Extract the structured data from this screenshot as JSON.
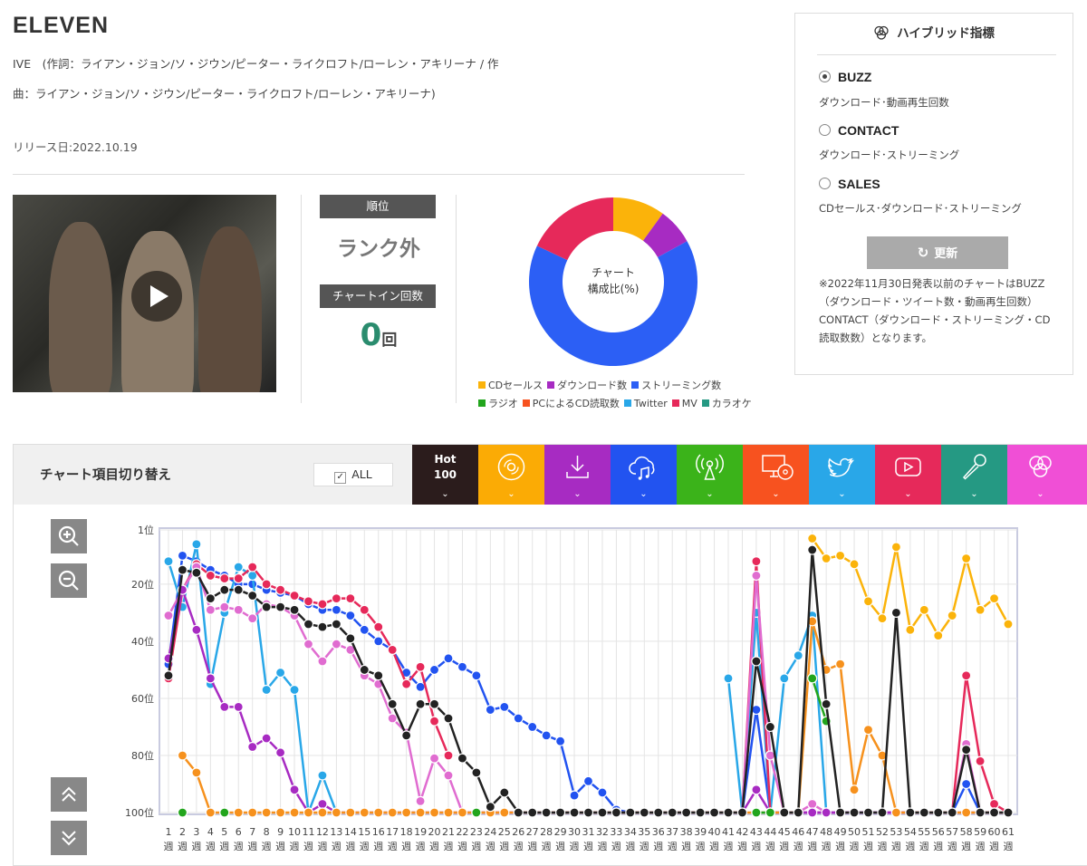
{
  "song": {
    "title": "ELEVEN",
    "credits": "IVE　(作詞：ライアン・ジョン/ソ・ジウン/ピーター・ライクロフト/ローレン・アキリーナ / 作曲：ライアン・ジョン/ソ・ジウン/ピーター・ライクロフト/ローレン・アキリーナ)",
    "release": "リリース日:2022.10.19"
  },
  "rank": {
    "label": "順位",
    "value": "ランク外",
    "chartin_label": "チャートイン回数",
    "chartin_value": "0",
    "chartin_unit": "回"
  },
  "donut": {
    "center_line1": "チャート",
    "center_line2": "構成比(%)",
    "slices": [
      {
        "name": "CDセールス",
        "percent": 10,
        "color": "#fbb30a"
      },
      {
        "name": "ダウンロード数",
        "percent": 7,
        "color": "#a72bc2"
      },
      {
        "name": "ストリーミング数",
        "percent": 65,
        "color": "#2c5ff5"
      },
      {
        "name": "MV",
        "percent": 18,
        "color": "#e6295a"
      }
    ]
  },
  "legend": [
    {
      "label": "CDセールス",
      "color": "#fbb30a"
    },
    {
      "label": "ダウンロード数",
      "color": "#a72bc2"
    },
    {
      "label": "ストリーミング数",
      "color": "#2c5ff5"
    },
    {
      "label": "ラジオ",
      "color": "#22a51d"
    },
    {
      "label": "PCによるCD読取数",
      "color": "#f7521f"
    },
    {
      "label": "Twitter",
      "color": "#29a7e8"
    },
    {
      "label": "MV",
      "color": "#e6295a"
    },
    {
      "label": "カラオケ",
      "color": "#259983"
    }
  ],
  "hybrid": {
    "title": "ハイブリッド指標",
    "options": [
      {
        "label": "BUZZ",
        "desc": "ダウンロード･動画再生回数",
        "selected": true
      },
      {
        "label": "CONTACT",
        "desc": "ダウンロード･ストリーミング",
        "selected": false
      },
      {
        "label": "SALES",
        "desc": "CDセールス･ダウンロード･ストリーミング",
        "selected": false
      }
    ],
    "refresh_label": "更新",
    "note": "※2022年11月30日発表以前のチャートはBUZZ（ダウンロード・ツイート数・動画再生回数）CONTACT（ダウンロード・ストリーミング・CD読取数数）となります。"
  },
  "toolbar": {
    "switch_label": "チャート項目切り替え",
    "all_label": "ALL",
    "hot_line1": "Hot",
    "hot_line2": "100",
    "tabs": [
      {
        "name": "hot100",
        "color": "#2b1c1c",
        "icon": "hot-100"
      },
      {
        "name": "cd",
        "color": "#fbab05",
        "icon": "cd-icon"
      },
      {
        "name": "download",
        "color": "#a72bc2",
        "icon": "download-icon"
      },
      {
        "name": "streaming",
        "color": "#2253f0",
        "icon": "cloud-music-icon"
      },
      {
        "name": "radio",
        "color": "#3bb31a",
        "icon": "radio-icon"
      },
      {
        "name": "pc-cd",
        "color": "#f7521f",
        "icon": "pc-cd-icon"
      },
      {
        "name": "twitter",
        "color": "#29a7e8",
        "icon": "twitter-icon"
      },
      {
        "name": "mv",
        "color": "#e6295a",
        "icon": "youtube-icon"
      },
      {
        "name": "karaoke",
        "color": "#259983",
        "icon": "microphone-icon"
      },
      {
        "name": "hybrid",
        "color": "#f04fd6",
        "icon": "venn-icon"
      }
    ]
  },
  "chart_data": {
    "type": "line",
    "y_axis": {
      "ticks": [
        "1位",
        "20位",
        "40位",
        "60位",
        "80位",
        "100位"
      ],
      "tick_values": [
        1,
        20,
        40,
        60,
        80,
        100
      ],
      "range": [
        1,
        100
      ],
      "inverted": true
    },
    "x_axis": {
      "unit": "週",
      "count": 61
    },
    "series": [
      {
        "color": "#2253f0",
        "values": [
          48,
          10,
          12,
          15,
          17,
          20,
          20,
          22,
          23,
          24,
          27,
          29,
          29,
          31,
          36,
          40,
          43,
          51,
          56,
          50,
          46,
          49,
          52,
          64,
          63,
          67,
          70,
          73,
          75,
          94,
          89,
          93,
          99,
          100,
          100,
          100,
          100,
          100,
          100,
          100,
          100,
          100,
          64,
          100,
          100,
          100,
          100,
          100,
          100,
          100,
          100,
          100,
          100,
          100,
          100,
          100,
          100,
          90,
          100,
          100,
          100
        ]
      },
      {
        "color": "#29a7e8",
        "values": [
          12,
          28,
          6,
          55,
          30,
          14,
          17,
          57,
          51,
          57,
          100,
          87,
          100,
          null,
          null,
          null,
          null,
          null,
          null,
          null,
          null,
          null,
          null,
          null,
          null,
          null,
          null,
          null,
          null,
          null,
          null,
          null,
          null,
          null,
          null,
          null,
          null,
          null,
          null,
          null,
          53,
          100,
          30,
          100,
          53,
          45,
          31,
          100,
          100,
          null,
          null,
          null,
          null,
          null,
          null,
          null,
          null,
          null,
          null,
          null,
          null
        ]
      },
      {
        "color": "#e6295a",
        "values": [
          53,
          22,
          13,
          17,
          18,
          18,
          14,
          20,
          22,
          24,
          26,
          27,
          25,
          25,
          29,
          35,
          43,
          55,
          49,
          68,
          80,
          null,
          null,
          null,
          null,
          null,
          null,
          null,
          null,
          null,
          null,
          null,
          null,
          null,
          null,
          null,
          null,
          null,
          null,
          null,
          null,
          100,
          12,
          100,
          100,
          100,
          100,
          100,
          100,
          100,
          100,
          100,
          100,
          100,
          100,
          100,
          100,
          52,
          82,
          97,
          100
        ]
      },
      {
        "color": "#e06cd0",
        "values": [
          31,
          22,
          14,
          29,
          28,
          29,
          32,
          27,
          28,
          31,
          41,
          47,
          41,
          43,
          52,
          55,
          67,
          72,
          96,
          81,
          87,
          100,
          100,
          100,
          100,
          100,
          100,
          100,
          100,
          100,
          100,
          100,
          100,
          100,
          100,
          100,
          100,
          100,
          100,
          100,
          100,
          100,
          17,
          80,
          100,
          100,
          97,
          100,
          100,
          100,
          100,
          100,
          100,
          100,
          100,
          100,
          100,
          76,
          100,
          100,
          100
        ]
      },
      {
        "color": "#a72bc2",
        "values": [
          46,
          22,
          36,
          53,
          63,
          63,
          77,
          74,
          79,
          92,
          100,
          97,
          100,
          100,
          100,
          100,
          100,
          100,
          100,
          100,
          100,
          100,
          100,
          100,
          100,
          100,
          100,
          100,
          100,
          100,
          100,
          100,
          100,
          100,
          100,
          100,
          100,
          100,
          100,
          100,
          100,
          100,
          92,
          100,
          100,
          100,
          100,
          100,
          100,
          100,
          100,
          100,
          100,
          100,
          100,
          100,
          100,
          100,
          100,
          100,
          100
        ]
      },
      {
        "color": "#f6911d",
        "values": [
          null,
          80,
          86,
          100,
          100,
          100,
          100,
          100,
          100,
          100,
          100,
          100,
          100,
          100,
          100,
          100,
          100,
          100,
          100,
          100,
          100,
          100,
          100,
          100,
          100,
          100,
          100,
          100,
          100,
          100,
          100,
          100,
          100,
          100,
          100,
          100,
          100,
          100,
          100,
          100,
          100,
          100,
          100,
          100,
          100,
          100,
          33,
          50,
          48,
          92,
          71,
          80,
          100,
          100,
          100,
          100,
          100,
          100,
          100,
          100,
          100
        ]
      },
      {
        "color": "#fbb30a",
        "values": [
          null,
          null,
          null,
          null,
          null,
          null,
          null,
          null,
          null,
          null,
          null,
          null,
          null,
          null,
          null,
          null,
          null,
          null,
          null,
          null,
          null,
          null,
          null,
          null,
          null,
          null,
          null,
          null,
          null,
          null,
          null,
          null,
          null,
          null,
          null,
          null,
          null,
          null,
          null,
          null,
          null,
          null,
          null,
          null,
          null,
          null,
          4,
          11,
          10,
          13,
          26,
          32,
          7,
          36,
          29,
          38,
          31,
          11,
          29,
          25,
          34
        ]
      },
      {
        "color": "#22a51d",
        "values": [
          null,
          100,
          null,
          null,
          100,
          null,
          null,
          null,
          null,
          null,
          null,
          null,
          null,
          null,
          null,
          null,
          null,
          null,
          null,
          null,
          null,
          null,
          100,
          null,
          null,
          null,
          null,
          null,
          null,
          null,
          null,
          null,
          null,
          null,
          null,
          null,
          null,
          null,
          null,
          null,
          null,
          null,
          100,
          100,
          null,
          null,
          53,
          68,
          null,
          null,
          null,
          null,
          null,
          null,
          null,
          null,
          null,
          null,
          null,
          null,
          null
        ]
      },
      {
        "color": "#222222",
        "values": [
          52,
          15,
          16,
          25,
          22,
          22,
          24,
          28,
          28,
          29,
          34,
          35,
          34,
          39,
          50,
          52,
          62,
          73,
          62,
          62,
          67,
          81,
          86,
          98,
          93,
          100,
          100,
          100,
          100,
          100,
          100,
          100,
          100,
          100,
          100,
          100,
          100,
          100,
          100,
          100,
          100,
          100,
          47,
          70,
          100,
          100,
          8,
          62,
          100,
          100,
          100,
          100,
          30,
          100,
          100,
          100,
          100,
          78,
          100,
          100,
          100
        ]
      }
    ]
  }
}
